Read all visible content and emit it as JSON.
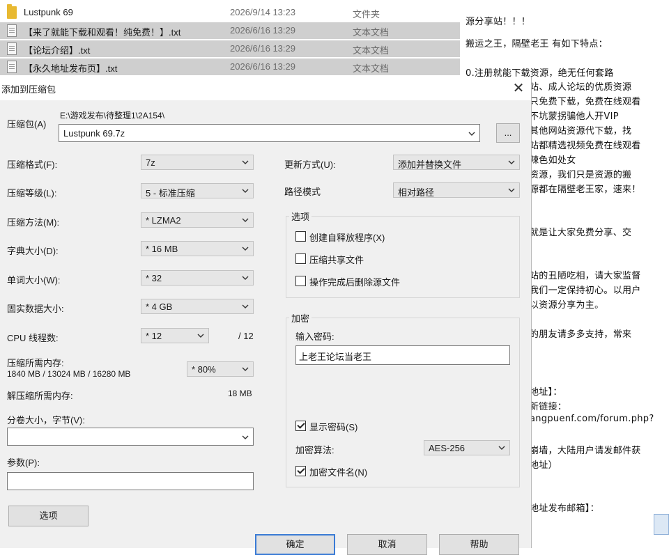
{
  "explorer": {
    "files": [
      {
        "name": "Lustpunk 69",
        "date": "2026/9/14 13:23",
        "type": "文件夹",
        "icon": "folder-icon"
      },
      {
        "name": "【来了就能下载和观看！纯免费！】.txt",
        "date": "2026/6/16 13:29",
        "type": "文本文档",
        "icon": "text-file-icon"
      },
      {
        "name": "【论坛介绍】.txt",
        "date": "2026/6/16 13:29",
        "type": "文本文档",
        "icon": "text-file-icon"
      },
      {
        "name": "【永久地址发布页】.txt",
        "date": "2026/6/16 13:29",
        "type": "文本文档",
        "icon": "text-file-icon"
      }
    ]
  },
  "notepad": {
    "lines_top": [
      "源分享站！！！",
      "搬运之王，隔壁老王 有如下特点：",
      "0.注册就能下载资源，绝无任何套路"
    ],
    "lines_right": [
      "站、成人论坛的优质资源",
      "只免费下载，免费在线观看",
      "不坑蒙拐骗他人开VIP",
      "其他网站资源代下载，找",
      "站都精选视频免费在线观看",
      "辣色如处女",
      "资源，我们只是资源的搬",
      "源都在隔壁老王家，速来！",
      "就是让大家免费分享、交",
      "站的丑陋吃相，请大家监督",
      "我们一定保持初心。以用户",
      "以资源分享为主。",
      "的朋友请多多支持，常来",
      "地址】：",
      "新链接：",
      "angpuenf.com/forum.php?",
      "崩墙，大陆用户请发邮件获",
      "地址）",
      "地址发布邮箱】："
    ]
  },
  "dialog": {
    "title": "添加到压缩包",
    "close": "✕",
    "archive_label": "压缩包(A)",
    "archive_path": "E:\\游戏发布\\待整理1\\2A154\\",
    "archive_name": "Lustpunk 69.7z",
    "browse": "...",
    "format_label": "压缩格式(F):",
    "format_value": "7z",
    "level_label": "压缩等级(L):",
    "level_value": "5 - 标准压缩",
    "method_label": "压缩方法(M):",
    "method_value": "* LZMA2",
    "dict_label": "字典大小(D):",
    "dict_value": "* 16 MB",
    "word_label": "单词大小(W):",
    "word_value": "* 32",
    "solid_label": "固实数据大小:",
    "solid_value": "* 4 GB",
    "cpu_label": "CPU 线程数:",
    "cpu_value": "* 12",
    "cpu_max": "/ 12",
    "mem_label": "压缩所需内存:",
    "mem_value": "1840 MB / 13024 MB / 16280 MB",
    "mem_percent": "* 80%",
    "decomp_label": "解压缩所需内存:",
    "decomp_value": "18 MB",
    "split_label": "分卷大小，字节(V):",
    "split_value": "",
    "params_label": "参数(P):",
    "params_value": "",
    "update_label": "更新方式(U):",
    "update_value": "添加并替换文件",
    "path_label": "路径模式",
    "path_value": "相对路径",
    "options_title": "选项",
    "opt_sfx": "创建自释放程序(X)",
    "opt_shared": "压缩共享文件",
    "opt_delete": "操作完成后删除源文件",
    "enc_title": "加密",
    "pwd_label": "输入密码:",
    "pwd_value": "上老王论坛当老王",
    "show_pwd": "显示密码(S)",
    "enc_method_label": "加密算法:",
    "enc_method_value": "AES-256",
    "enc_names": "加密文件名(N)",
    "options_button": "选项",
    "ok": "确定",
    "cancel": "取消",
    "help": "帮助"
  }
}
